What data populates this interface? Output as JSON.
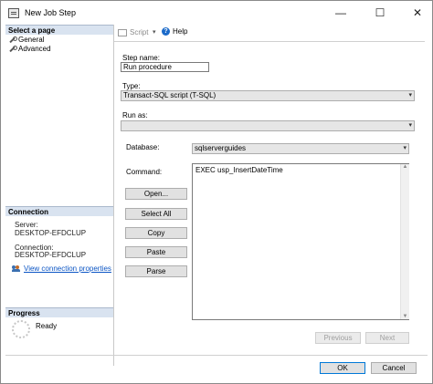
{
  "window": {
    "title": "New Job Step",
    "minimize": "—",
    "maximize": "☐",
    "close": "✕"
  },
  "left_pane": {
    "select_page_header": "Select a page",
    "pages": [
      {
        "label": "General",
        "icon": "wrench-icon"
      },
      {
        "label": "Advanced",
        "icon": "wrench-icon"
      }
    ],
    "connection_header": "Connection",
    "server_label": "Server:",
    "server_value": "DESKTOP-EFDCLUP",
    "connection_label": "Connection:",
    "connection_value": "DESKTOP-EFDCLUP",
    "view_connection_link": "View connection properties",
    "progress_header": "Progress",
    "progress_status": "Ready"
  },
  "toolbar": {
    "script_label": "Script",
    "script_dropdown": "▾",
    "help_label": "Help"
  },
  "form": {
    "step_name_label": "Step name:",
    "step_name_value": "Run procedure",
    "type_label": "Type:",
    "type_value": "Transact-SQL script (T-SQL)",
    "run_as_label": "Run as:",
    "run_as_value": "",
    "database_label": "Database:",
    "database_value": "sqlserverguides",
    "command_label": "Command:",
    "command_value": "EXEC usp_InsertDateTime"
  },
  "command_buttons": {
    "open": "Open...",
    "select_all": "Select All",
    "copy": "Copy",
    "paste": "Paste",
    "parse": "Parse"
  },
  "nav_buttons": {
    "previous": "Previous",
    "next": "Next"
  },
  "dialog_buttons": {
    "ok": "OK",
    "cancel": "Cancel"
  }
}
